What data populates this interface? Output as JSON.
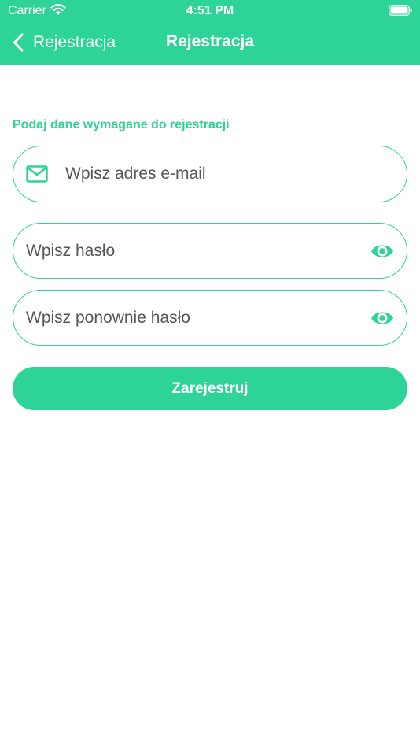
{
  "status_bar": {
    "carrier": "Carrier",
    "time": "4:51 PM"
  },
  "nav": {
    "back_label": "Rejestracja",
    "title": "Rejestracja"
  },
  "form": {
    "section_label": "Podaj dane wymagane do rejestracji",
    "email_placeholder": "Wpisz adres e-mail",
    "password_placeholder": "Wpisz hasło",
    "password_repeat_placeholder": "Wpisz ponownie hasło",
    "submit_label": "Zarejestruj"
  },
  "colors": {
    "accent": "#2ed397",
    "header_text": "#ffffff",
    "placeholder_text": "#555555"
  },
  "icons": {
    "back": "chevron-left-icon",
    "email": "mail-icon",
    "password_toggle": "eye-icon"
  }
}
